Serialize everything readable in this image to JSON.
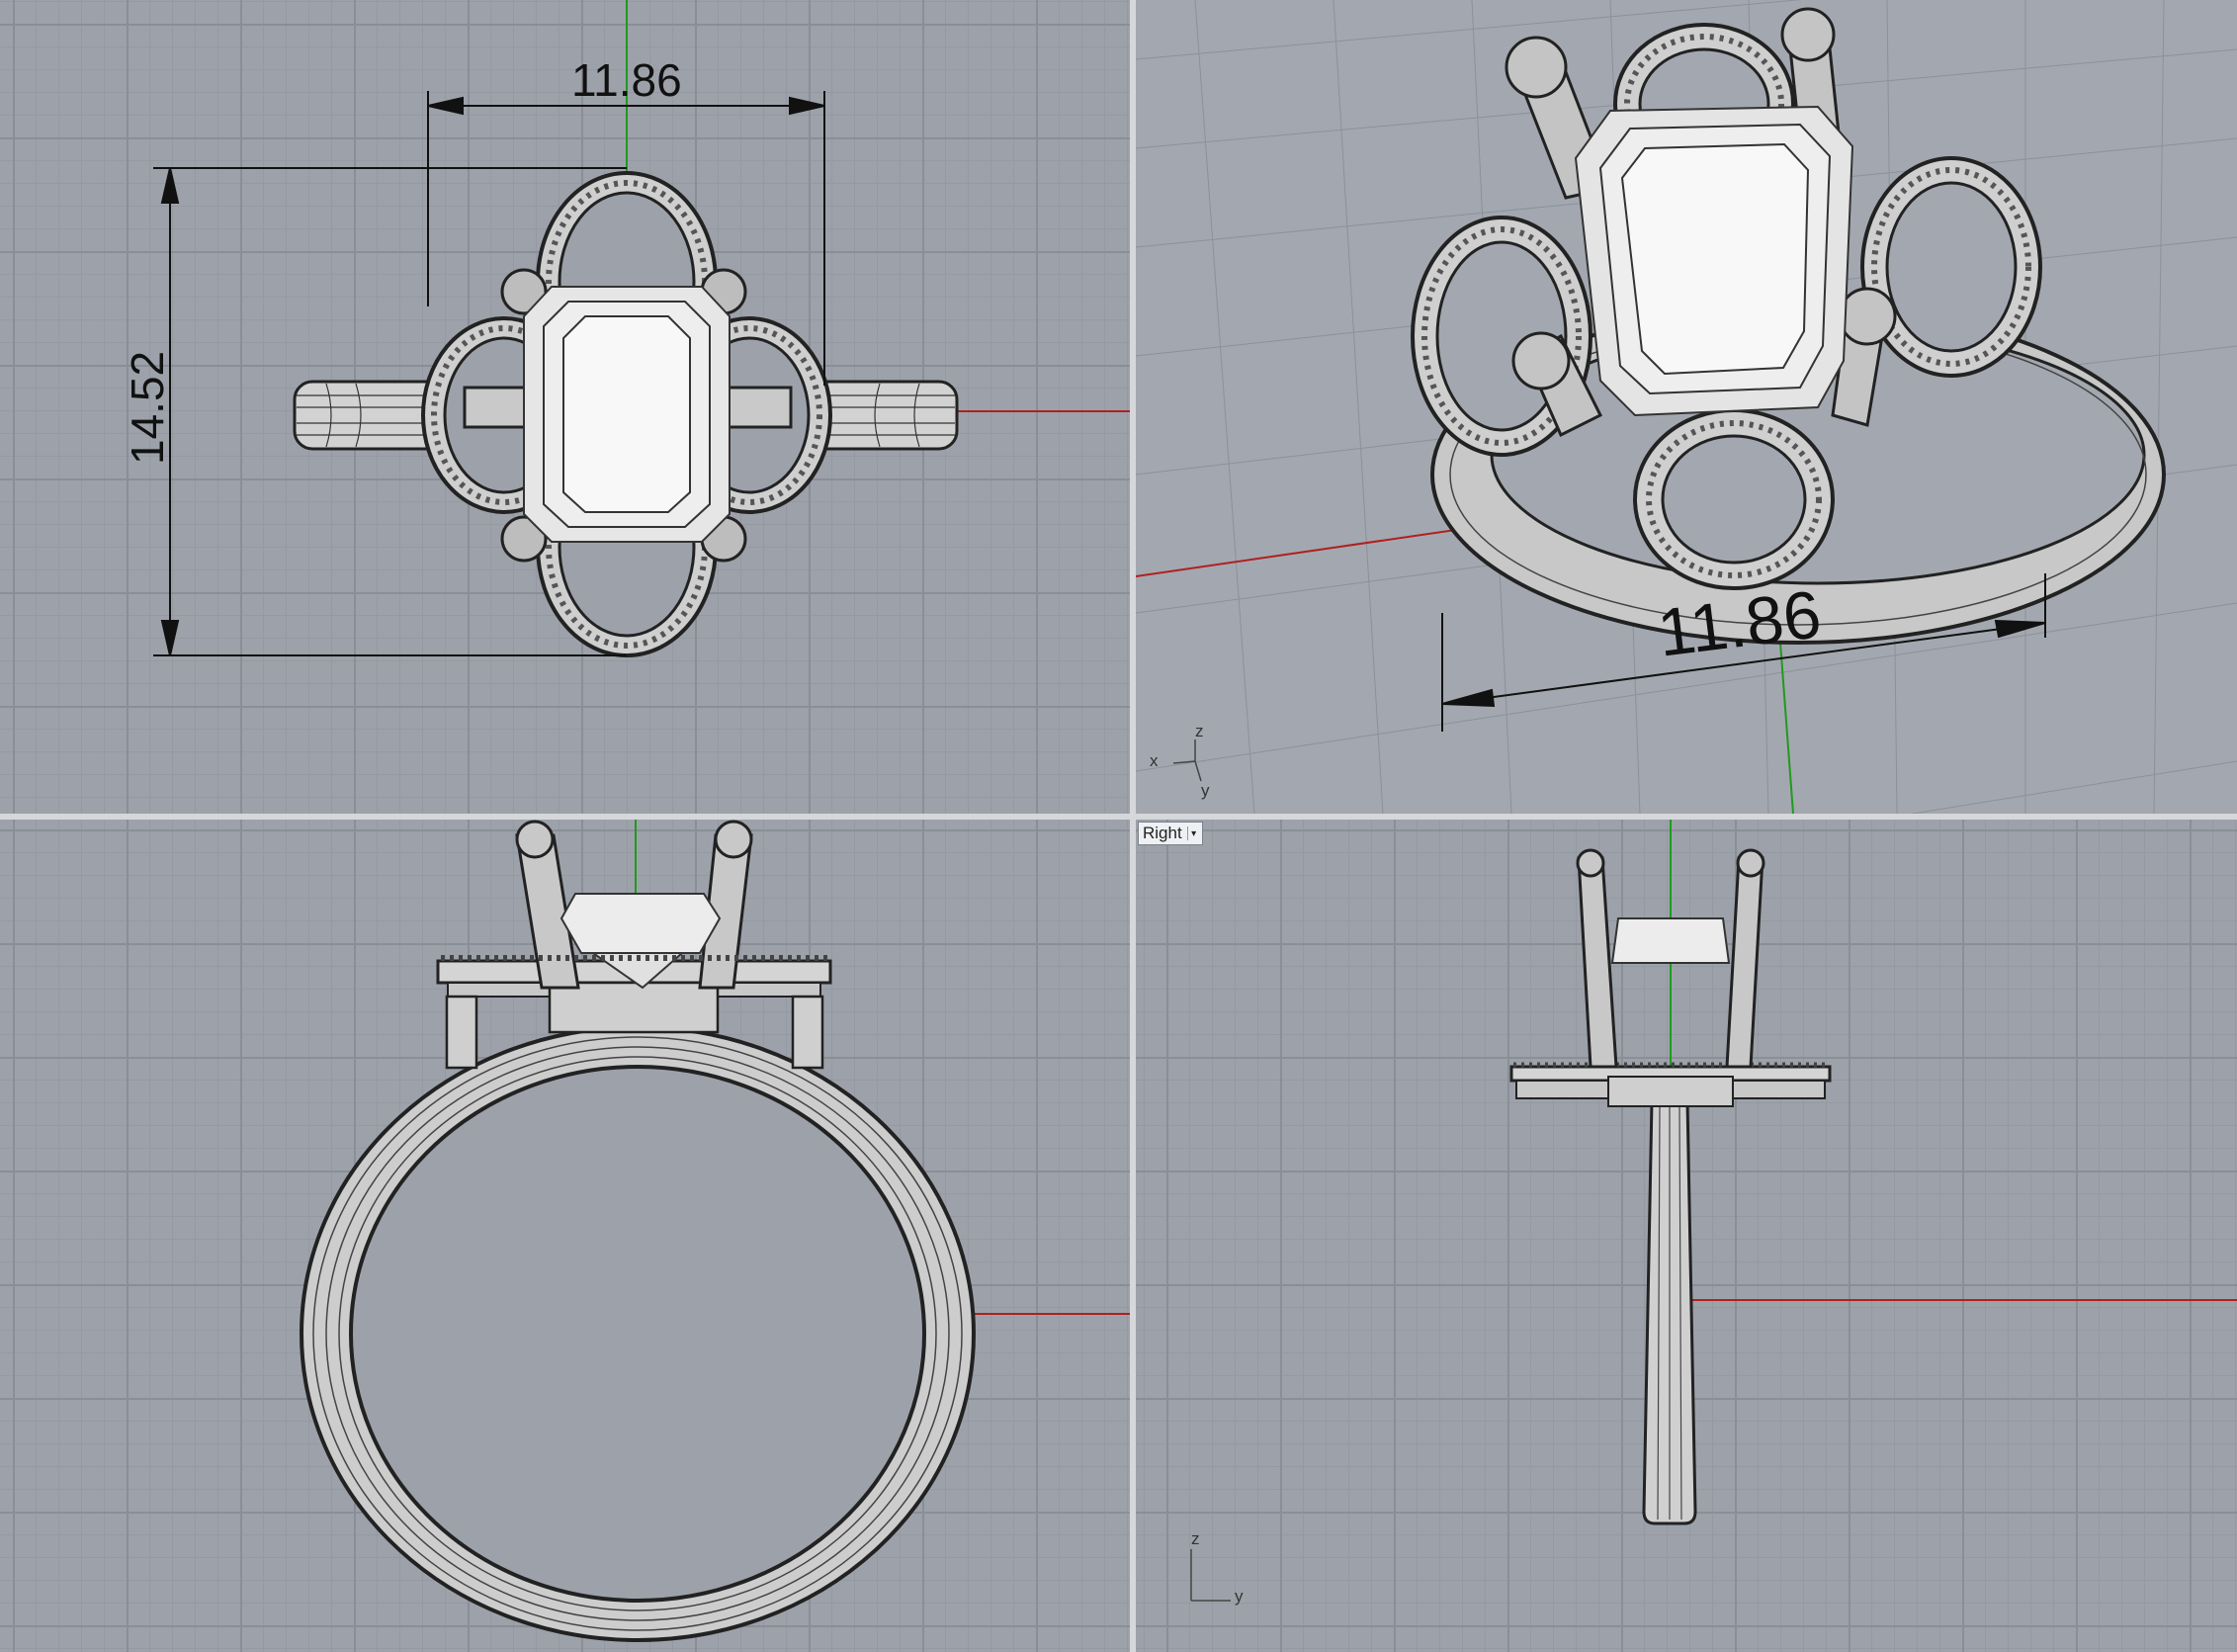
{
  "viewports": {
    "top": {
      "dimensions": {
        "width": "11.86",
        "height": "14.52"
      }
    },
    "perspective": {
      "dimension": "11.86",
      "gumball": {
        "x": "x",
        "y": "y",
        "z": "z"
      }
    },
    "front": {},
    "right": {
      "label": "Right",
      "axes": {
        "z": "z",
        "y": "y"
      }
    }
  },
  "colors": {
    "viewport_bg": "#9da2aa",
    "x_axis": "#b02020",
    "y_axis": "#1f9a1f",
    "stone": "#f2f2f2",
    "metal": "#d8d8d8"
  },
  "icons": {
    "viewport_menu": "chevron-down-icon"
  }
}
